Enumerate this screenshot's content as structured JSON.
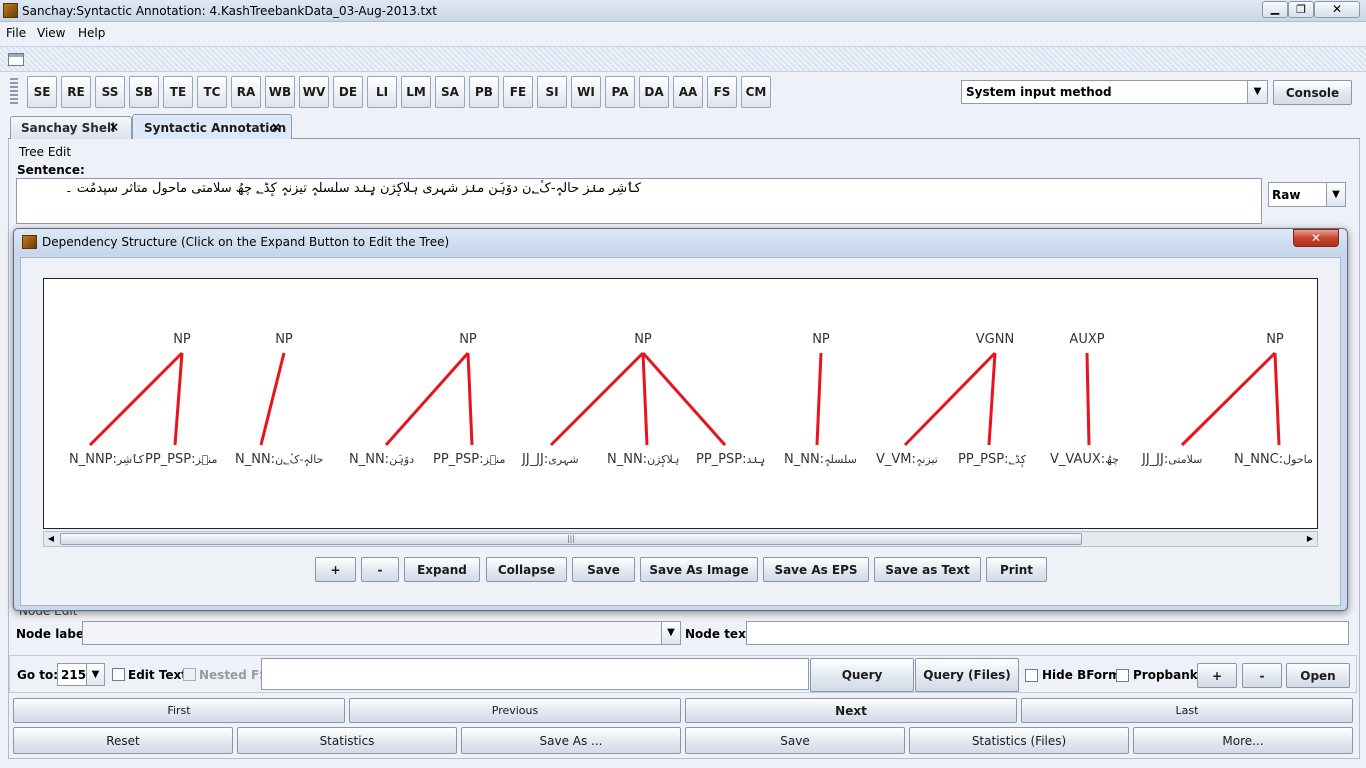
{
  "window": {
    "title": "Sanchay:Syntactic Annotation: 4.KashTreebankData_03-Aug-2013.txt"
  },
  "menu": [
    "File",
    "View",
    "Help"
  ],
  "toolbar": {
    "buttons": [
      "SE",
      "RE",
      "SS",
      "SB",
      "TE",
      "TC",
      "RA",
      "WB",
      "WV",
      "DE",
      "LI",
      "LM",
      "SA",
      "PB",
      "FE",
      "SI",
      "WI",
      "PA",
      "DA",
      "AA",
      "FS",
      "CM"
    ],
    "input_method": "System input method",
    "console_label": "Console"
  },
  "tabs": [
    {
      "label": "Sanchay Shell",
      "close": "×"
    },
    {
      "label": "Syntactic Annotation",
      "close": "×"
    }
  ],
  "tree_edit": {
    "group_label": "Tree Edit",
    "sentence_label": "Sentence:",
    "sentence_text": "کٲشِر منٛز حالہٕ-کٔ؂ن دوٚہَن منٛز شہری ہلاکٕژن ہٕنٛد سلسلہٕ تیزنہٕ کٕڈ؂ چھُ سلامتی ماحول متاثر سپدمُت ۔",
    "format_value": "Raw"
  },
  "dialog": {
    "title": "Dependency Structure (Click on the Expand Button to Edit the Tree)",
    "close": "✕",
    "buttons": {
      "zoom_in": "+",
      "zoom_out": "-",
      "expand": "Expand",
      "collapse": "Collapse",
      "save": "Save",
      "save_image": "Save As Image",
      "save_eps": "Save As EPS",
      "save_text": "Save as Text",
      "print": "Print"
    }
  },
  "tree": {
    "phrases": [
      {
        "label": "NP",
        "leaves": [
          {
            "tag": "N_NNP",
            "word": "کٲشِر"
          },
          {
            "tag": "PP_PSP",
            "word": "منٛز"
          }
        ]
      },
      {
        "label": "NP",
        "leaves": [
          {
            "tag": "N_NN",
            "word": "حالہٕ-کٔ؂ن"
          }
        ]
      },
      {
        "label": "NP",
        "leaves": [
          {
            "tag": "N_NN",
            "word": "دوٚہَن"
          },
          {
            "tag": "PP_PSP",
            "word": "منٛز"
          }
        ]
      },
      {
        "label": "NP",
        "leaves": [
          {
            "tag": "JJ_JJ",
            "word": "شہری"
          },
          {
            "tag": "N_NN",
            "word": "ہلاکٕژن"
          },
          {
            "tag": "PP_PSP",
            "word": "ہٕنٛد"
          }
        ]
      },
      {
        "label": "NP",
        "leaves": [
          {
            "tag": "N_NN",
            "word": "سلسلہٕ"
          }
        ]
      },
      {
        "label": "VGNN",
        "leaves": [
          {
            "tag": "V_VM",
            "word": "تیزنہٕ"
          },
          {
            "tag": "PP_PSP",
            "word": "کٕڈ؂"
          }
        ]
      },
      {
        "label": "AUXP",
        "leaves": [
          {
            "tag": "V_VAUX",
            "word": "چھُ"
          }
        ]
      },
      {
        "label": "NP",
        "leaves": [
          {
            "tag": "JJ_JJ",
            "word": "سلامتی"
          },
          {
            "tag": "N_NNC",
            "word": "ماحول"
          }
        ]
      }
    ],
    "edge_color": "#e8141c"
  },
  "node_row": {
    "hidden_label": "Node Edit",
    "node_label": "Node label:",
    "node_text": "Node text:"
  },
  "goto": {
    "label": "Go to:",
    "value": "215",
    "edit_text": "Edit Text",
    "nested_fs": "Nested FS",
    "query": "Query",
    "query_files": "Query (Files)",
    "hide_bform": "Hide BForm",
    "propbank": "Propbank",
    "plus": "+",
    "minus": "-",
    "open": "Open"
  },
  "nav": {
    "first": "First",
    "previous": "Previous",
    "next": "Next",
    "last": "Last"
  },
  "bottom": {
    "reset": "Reset",
    "statistics": "Statistics",
    "save_as": "Save As ...",
    "save": "Save",
    "statistics_files": "Statistics (Files)",
    "more": "More..."
  }
}
